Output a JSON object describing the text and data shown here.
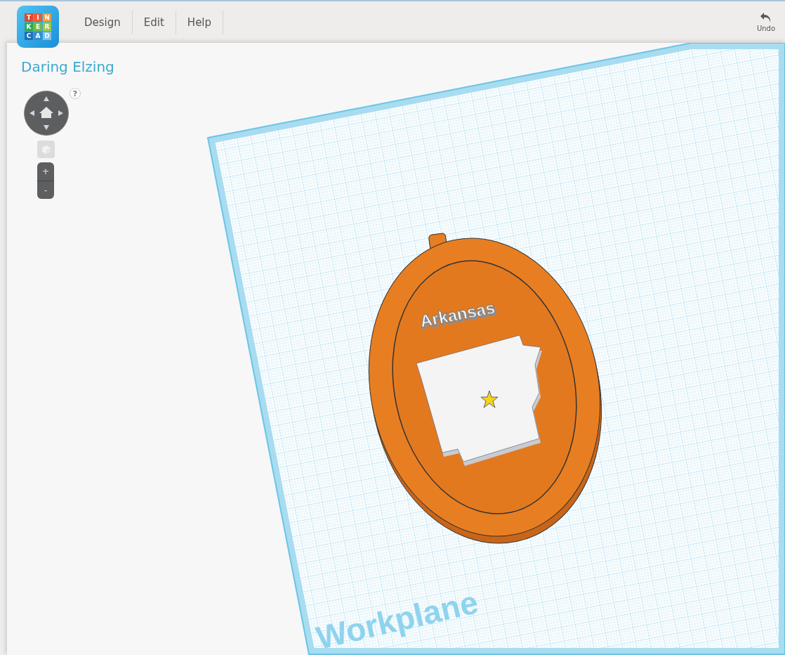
{
  "logo": {
    "letters": [
      "T",
      "I",
      "N",
      "K",
      "E",
      "R",
      "C",
      "A",
      "D"
    ]
  },
  "menu": [
    {
      "label": "Design"
    },
    {
      "label": "Edit"
    },
    {
      "label": "Help"
    }
  ],
  "undo": {
    "label": "Undo"
  },
  "design_title": "Daring Elzing",
  "view_controls": {
    "help": "?",
    "zoom_in": "+",
    "zoom_out": "-"
  },
  "scene": {
    "model_text": "Arkansas",
    "workplane_label": "Workplane"
  }
}
